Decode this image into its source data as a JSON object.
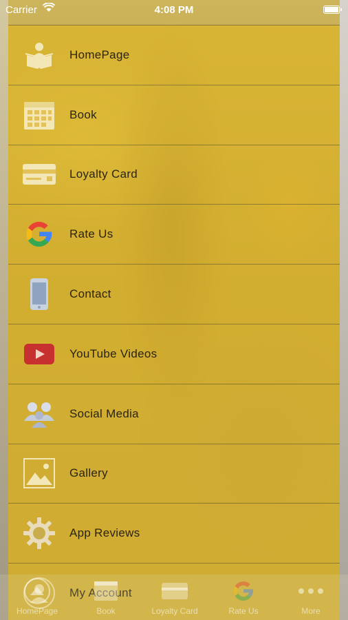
{
  "status_bar": {
    "carrier": "Carrier",
    "time": "4:08 PM",
    "battery_level": 1.0
  },
  "menu": {
    "items": [
      {
        "label": "HomePage",
        "icon": "home-book-icon"
      },
      {
        "label": "Book",
        "icon": "calendar-icon"
      },
      {
        "label": "Loyalty Card",
        "icon": "loyalty-card-icon"
      },
      {
        "label": "Rate Us",
        "icon": "google-icon"
      },
      {
        "label": "Contact",
        "icon": "phone-icon"
      },
      {
        "label": "YouTube Videos",
        "icon": "youtube-icon"
      },
      {
        "label": "Social Media",
        "icon": "social-people-icon"
      },
      {
        "label": "Gallery",
        "icon": "gallery-image-icon"
      },
      {
        "label": "App Reviews",
        "icon": "gear-icon"
      },
      {
        "label": "My Account",
        "icon": "account-icon"
      }
    ]
  },
  "tab_bar": {
    "tabs": [
      {
        "label": "HomePage",
        "icon": "home-icon"
      },
      {
        "label": "Book",
        "icon": "calendar-icon"
      },
      {
        "label": "Loyalty Card",
        "icon": "loyalty-card-icon"
      },
      {
        "label": "Rate Us",
        "icon": "google-icon"
      },
      {
        "label": "More",
        "icon": "more-dots-icon"
      }
    ]
  },
  "colors": {
    "menu_overlay": "#deb628",
    "text": "#2b2410",
    "youtube_red": "#c8302f"
  }
}
